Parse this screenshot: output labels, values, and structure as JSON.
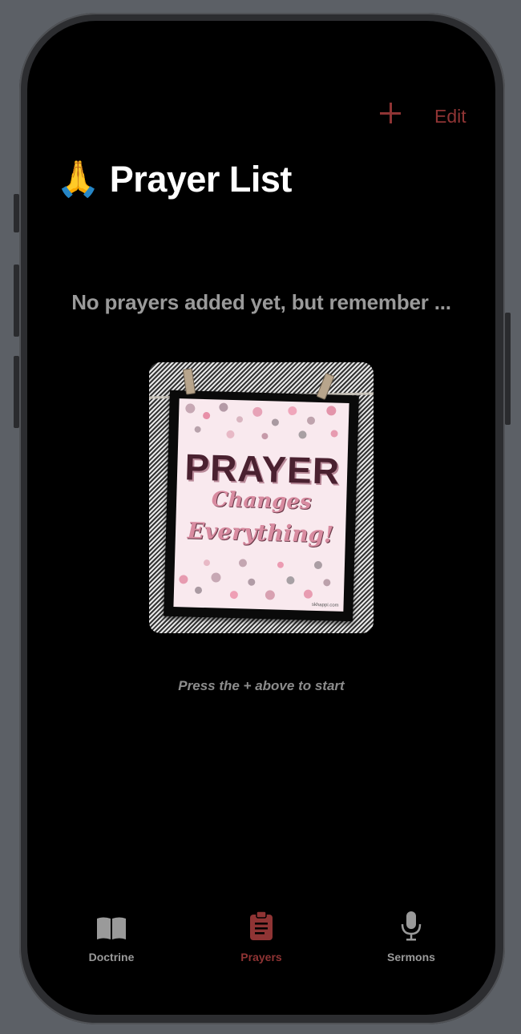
{
  "nav": {
    "add_label": "+",
    "edit_label": "Edit"
  },
  "header": {
    "emoji": "🙏",
    "title": "Prayer List"
  },
  "empty_state": {
    "message": "No prayers added yet, but remember ...",
    "hint": "Press the + above to start"
  },
  "poster": {
    "line1": "PRAYER",
    "line2": "Changes",
    "line3": "Everything!",
    "credit": "skhappi.com"
  },
  "tabs": [
    {
      "label": "Doctrine",
      "icon": "book-icon",
      "active": false
    },
    {
      "label": "Prayers",
      "icon": "clipboard-icon",
      "active": true
    },
    {
      "label": "Sermons",
      "icon": "microphone-icon",
      "active": false
    }
  ],
  "colors": {
    "accent": "#8f3434",
    "inactive": "#9a9a9a",
    "background": "#000000"
  }
}
